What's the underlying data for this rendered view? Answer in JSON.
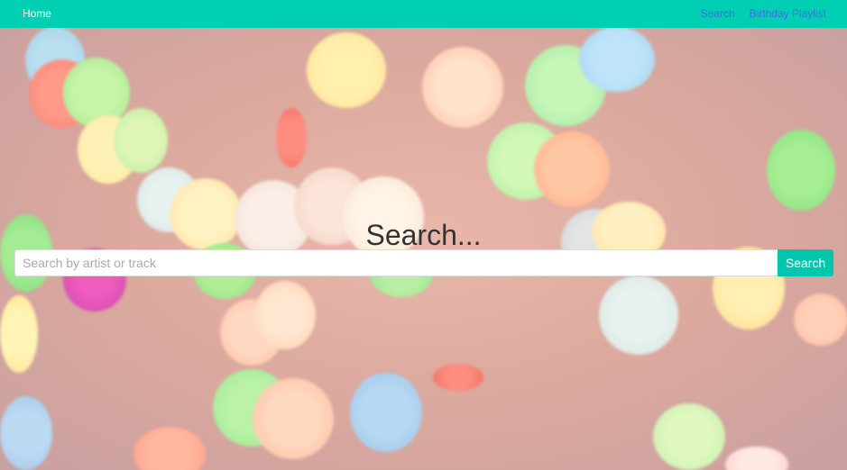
{
  "navbar": {
    "home_label": "Home",
    "links": [
      {
        "label": "Search"
      },
      {
        "label": "Birthday Playlist"
      }
    ]
  },
  "main": {
    "heading": "Search...",
    "search": {
      "placeholder": "Search by artist or track",
      "value": "",
      "button_label": "Search"
    }
  },
  "colors": {
    "navbar_bg": "#00cfb4",
    "button_bg": "#00c6ad",
    "nav_link": "#3b6fe0"
  }
}
